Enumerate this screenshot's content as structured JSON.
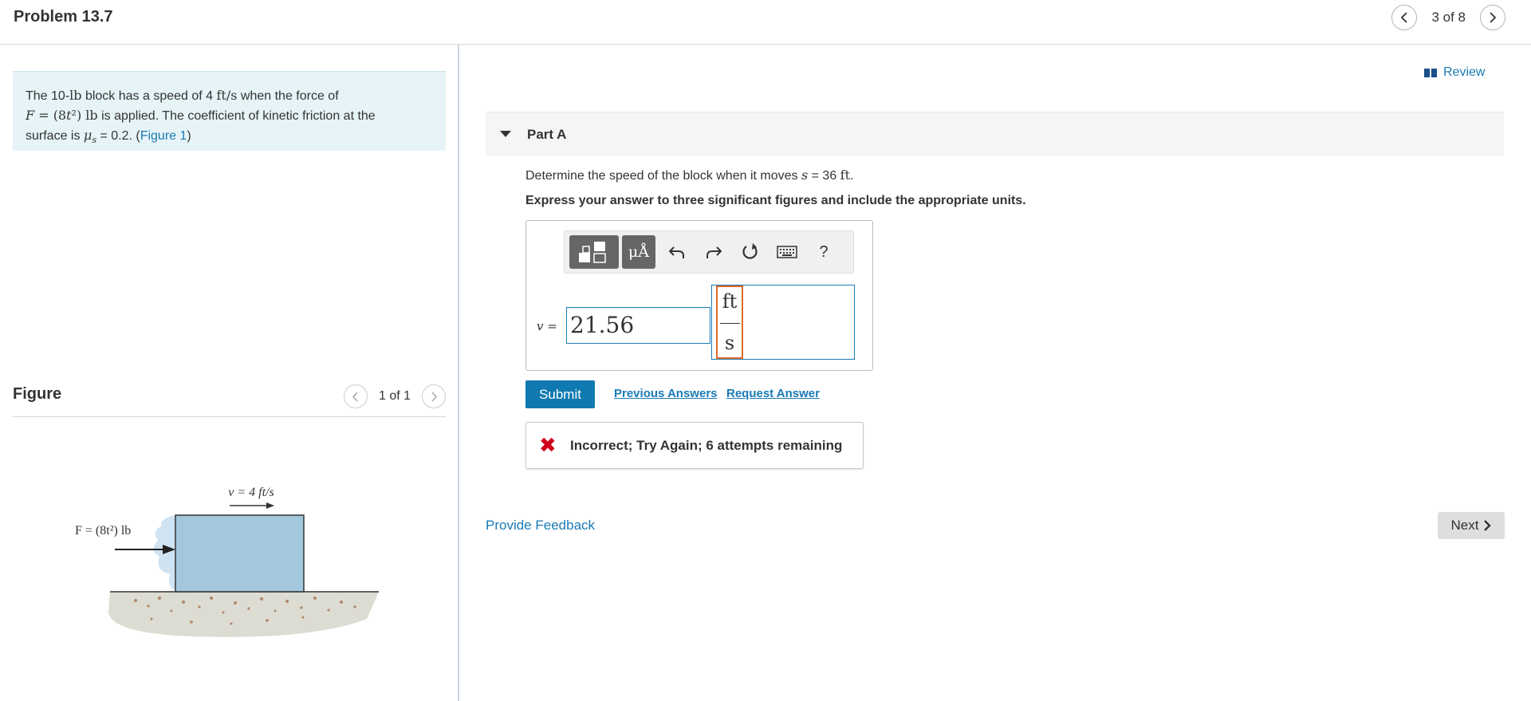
{
  "header": {
    "title": "Problem 13.7",
    "pager_text": "3 of 8",
    "prev_glyph": "<",
    "next_glyph": ">"
  },
  "problem": {
    "line1_a": "The 10-",
    "line1_b": "lb",
    "line1_c": " block has a speed of 4 ",
    "line1_d": "ft/s",
    "line1_e": " when the force of",
    "line2_a": "F",
    "line2_b": " = (8",
    "line2_c": "t",
    "line2_d": "²) lb",
    "line2_e": " is applied. The coefficient of kinetic friction at the",
    "line3_a": "surface is ",
    "line3_b": "μ",
    "line3_c": "s",
    "line3_d": " = 0.2. (",
    "line3_link": "Figure 1",
    "line3_e": ")"
  },
  "figure": {
    "title": "Figure",
    "pager_text": "1 of 1",
    "velocity_label": "v = 4 ft/s",
    "force_label": "F = (8t²) lb"
  },
  "review": {
    "label": "Review"
  },
  "part": {
    "title": "Part A",
    "question_a": "Determine the speed of the block when it moves ",
    "question_b": "s",
    "question_c": " = 36 ",
    "question_d": "ft",
    "question_e": ".",
    "instruction": "Express your answer to three significant figures and include the appropriate units."
  },
  "answer": {
    "var_label": "v =",
    "value": "21.56",
    "unit_numerator": "ft",
    "unit_denominator": "s",
    "toolbar_mu_label": "μÅ",
    "toolbar_help": "?"
  },
  "actions": {
    "submit": "Submit",
    "previous_answers": "Previous Answers",
    "request_answer": "Request Answer"
  },
  "feedback": {
    "icon": "✖",
    "message": "Incorrect; Try Again; 6 attempts remaining"
  },
  "footer": {
    "provide_feedback": "Provide Feedback",
    "next": "Next"
  },
  "colors": {
    "accent": "#0f7ab0",
    "link": "#1a7ab5",
    "error": "#d0021b",
    "problem_bg": "#e6f4f7",
    "block_fill": "#a3c8de"
  }
}
